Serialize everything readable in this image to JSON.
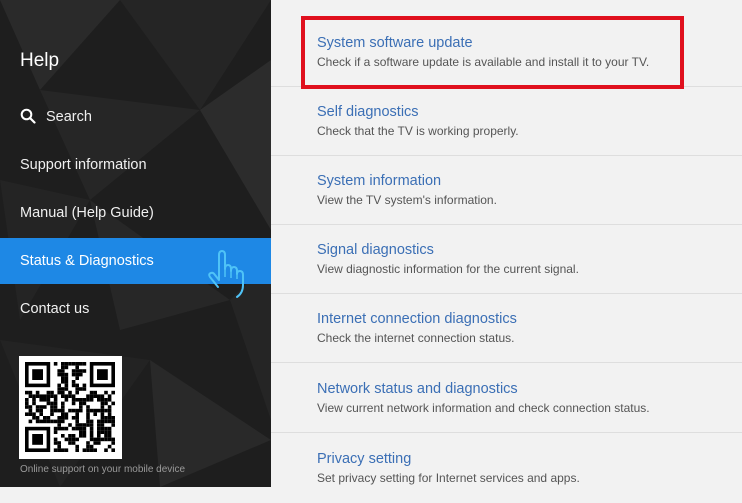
{
  "sidebar": {
    "title": "Help",
    "search_label": "Search",
    "items": [
      {
        "label": "Support information"
      },
      {
        "label": "Manual (Help Guide)"
      },
      {
        "label": "Status & Diagnostics"
      },
      {
        "label": "Contact us"
      }
    ],
    "active_item": "Status & Diagnostics",
    "qr_caption": "Online support on your mobile device"
  },
  "content": {
    "rows": [
      {
        "title": "System software update",
        "desc": "Check if a software update is available and install it to your TV."
      },
      {
        "title": "Self diagnostics",
        "desc": "Check that the TV is working properly."
      },
      {
        "title": "System information",
        "desc": "View the TV system's information."
      },
      {
        "title": "Signal diagnostics",
        "desc": "View diagnostic information for the current signal."
      },
      {
        "title": "Internet connection diagnostics",
        "desc": "Check the internet connection status."
      },
      {
        "title": "Network status and diagnostics",
        "desc": "View current network information and check connection status."
      },
      {
        "title": "Privacy setting",
        "desc": "Set privacy setting for Internet services and apps."
      }
    ]
  },
  "colors": {
    "accent": "#1e88e5",
    "link": "#3b6fb5",
    "highlight": "#e0101e",
    "sidebar_bg": "#1e1e1e"
  },
  "icons": {
    "search": "search-icon",
    "pointer": "hand-pointer-icon",
    "qr": "qr-code-icon"
  }
}
